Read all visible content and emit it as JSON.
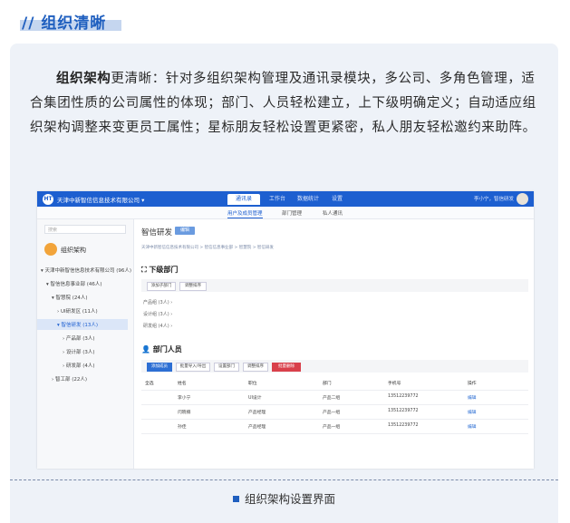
{
  "header": {
    "title": "// 组织清晰"
  },
  "intro": {
    "bold": "组织架构",
    "text": "更清晰：针对多组织架构管理及通讯录模块，多公司、多角色管理，适合集团性质的公司属性的体现；部门、人员轻松建立，上下级明确定义；自动适应组织架构调整来变更员工属性；星标朋友轻松设置更紧密，私人朋友轻松邀约来助阵。"
  },
  "screenshot": {
    "logo": "HT",
    "company": "天津中新智信信息技术有限公司 ▾",
    "top_nav": [
      "通讯录",
      "工作台",
      "数据统计",
      "设置"
    ],
    "user": "李小宁，智信研发",
    "sub_nav": [
      "用户及成员管理",
      "部门管理",
      "私人通讯"
    ],
    "sidebar": {
      "search_placeholder": "搜索",
      "title": "组织架构",
      "tree": [
        "▾  天津中新智信信息技术有限公司 (96人)",
        "▾  智信信息事业部 (46人)",
        "▾  智慧院 (24人)",
        "›  UI研发区 (11人)",
        "▾  智信研发 (13人)",
        "›  产品部 (3人)",
        "›  设计部 (3人)",
        "›  研发部 (4人)",
        "›  智工部 (22人)"
      ]
    },
    "dept_title": "智信研发",
    "edit_btn": "编辑",
    "breadcrumb": "天津中新智信信息技术有限公司 > 智信信息事业部 > 智慧院 > 智信研发",
    "subdept_title": "下级部门",
    "subdept_buttons": [
      "添加子部门",
      "调整排序"
    ],
    "subdepts": [
      "产品组 (3人)  ›",
      "设计组 (3人)  ›",
      "研发组 (4人)  ›"
    ],
    "members_title": "部门人员",
    "member_buttons": [
      "添加成员",
      "批量导入/导出",
      "设置部门",
      "调整排序",
      "批量删除"
    ],
    "table": {
      "headers": [
        "全选",
        "姓名",
        "职位",
        "部门",
        "手机号",
        "操作"
      ],
      "rows": [
        [
          "李小宁",
          "UI设计",
          "产品二组",
          "13512239772",
          "编辑"
        ],
        [
          "闫晓楠",
          "产品经理",
          "产品一组",
          "13512239772",
          "编辑"
        ],
        [
          "孙佳",
          "产品经理",
          "产品一组",
          "13512239772",
          "编辑"
        ]
      ]
    }
  },
  "caption": "组织架构设置界面"
}
